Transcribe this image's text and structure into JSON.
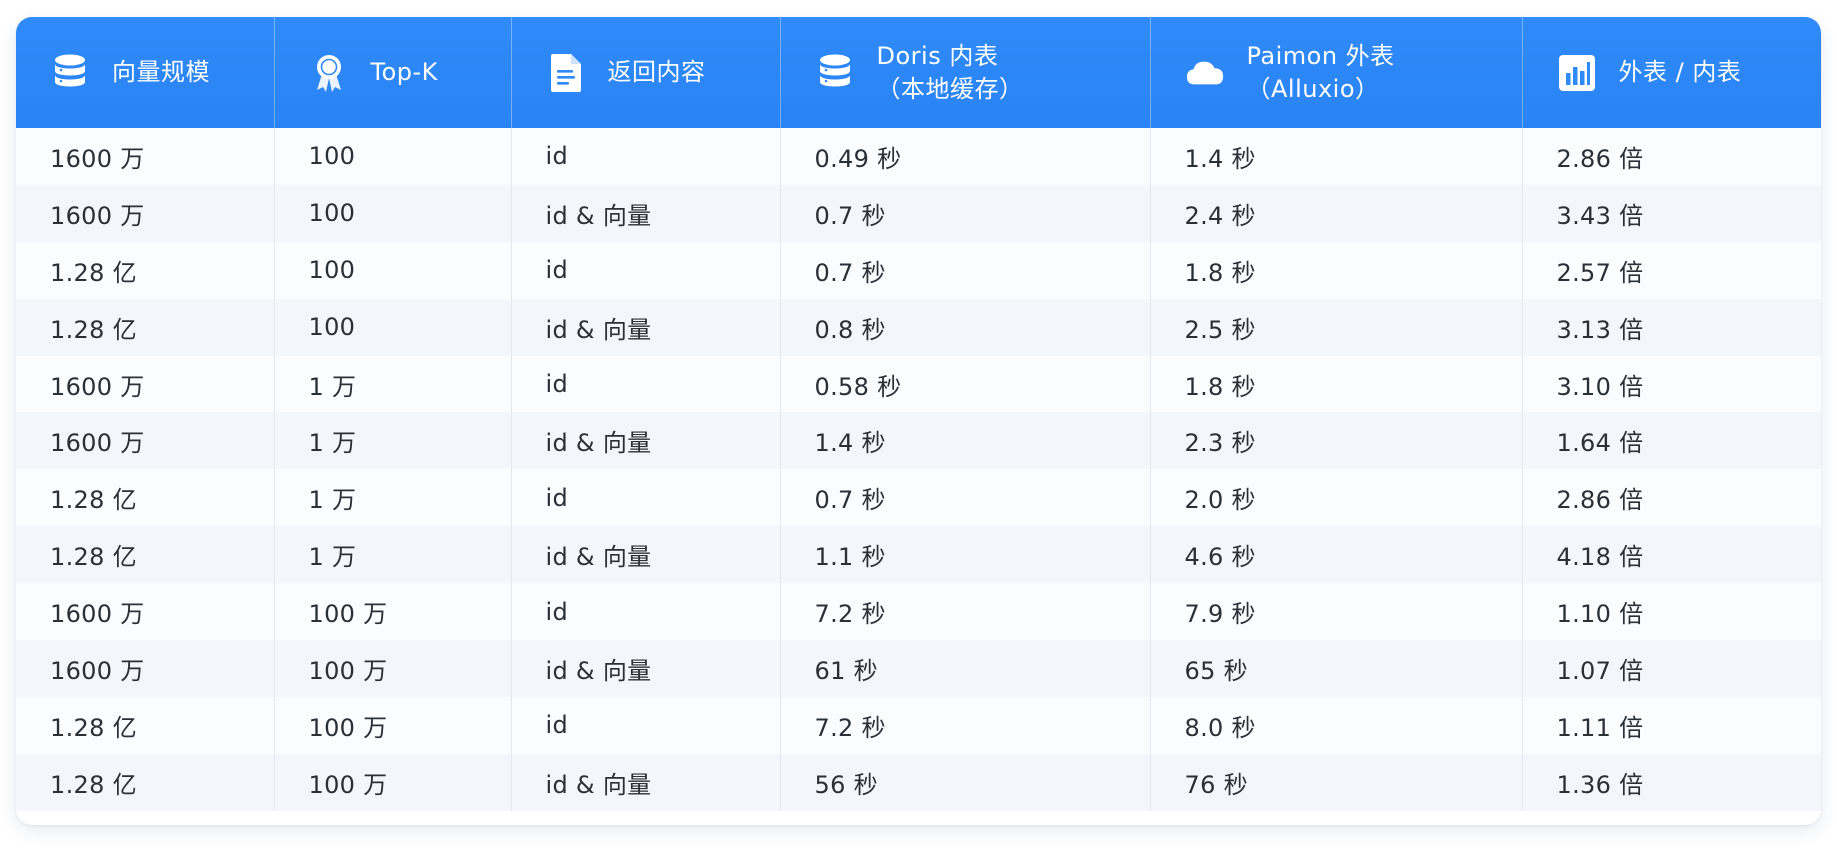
{
  "chart_data": {
    "type": "table",
    "columns": [
      {
        "label": [
          "向量规模"
        ],
        "icon": "database-icon"
      },
      {
        "label": [
          "Top-K"
        ],
        "icon": "award-badge-icon"
      },
      {
        "label": [
          "返回内容"
        ],
        "icon": "document-icon"
      },
      {
        "label": [
          "Doris 内表",
          "（本地缓存）"
        ],
        "icon": "database-icon"
      },
      {
        "label": [
          "Paimon 外表",
          "（Alluxio）"
        ],
        "icon": "cloud-icon"
      },
      {
        "label": [
          "外表 / 内表"
        ],
        "icon": "bar-chart-icon"
      }
    ],
    "rows": [
      [
        "1600 万",
        "100",
        "id",
        "0.49 秒",
        "1.4 秒",
        "2.86 倍"
      ],
      [
        "1600 万",
        "100",
        "id & 向量",
        "0.7 秒",
        "2.4 秒",
        "3.43 倍"
      ],
      [
        "1.28 亿",
        "100",
        "id",
        "0.7 秒",
        "1.8 秒",
        "2.57 倍"
      ],
      [
        "1.28 亿",
        "100",
        "id & 向量",
        "0.8 秒",
        "2.5 秒",
        "3.13 倍"
      ],
      [
        "1600 万",
        "1 万",
        "id",
        "0.58 秒",
        "1.8 秒",
        "3.10 倍"
      ],
      [
        "1600 万",
        "1 万",
        "id & 向量",
        "1.4 秒",
        "2.3 秒",
        "1.64 倍"
      ],
      [
        "1.28 亿",
        "1 万",
        "id",
        "0.7 秒",
        "2.0 秒",
        "2.86 倍"
      ],
      [
        "1.28 亿",
        "1 万",
        "id & 向量",
        "1.1 秒",
        "4.6 秒",
        "4.18 倍"
      ],
      [
        "1600 万",
        "100 万",
        "id",
        "7.2 秒",
        "7.9 秒",
        "1.10 倍"
      ],
      [
        "1600 万",
        "100 万",
        "id & 向量",
        "61 秒",
        "65 秒",
        "1.07 倍"
      ],
      [
        "1.28 亿",
        "100 万",
        "id",
        "7.2 秒",
        "8.0 秒",
        "1.11 倍"
      ],
      [
        "1.28 亿",
        "100 万",
        "id & 向量",
        "56 秒",
        "76 秒",
        "1.36 倍"
      ]
    ]
  },
  "colors": {
    "header_bg": "#2f8bf8",
    "header_text": "#ffffff",
    "row_odd": "#fbfcfe",
    "row_even": "#f3f6fb",
    "cell_text": "#2b2f36"
  }
}
